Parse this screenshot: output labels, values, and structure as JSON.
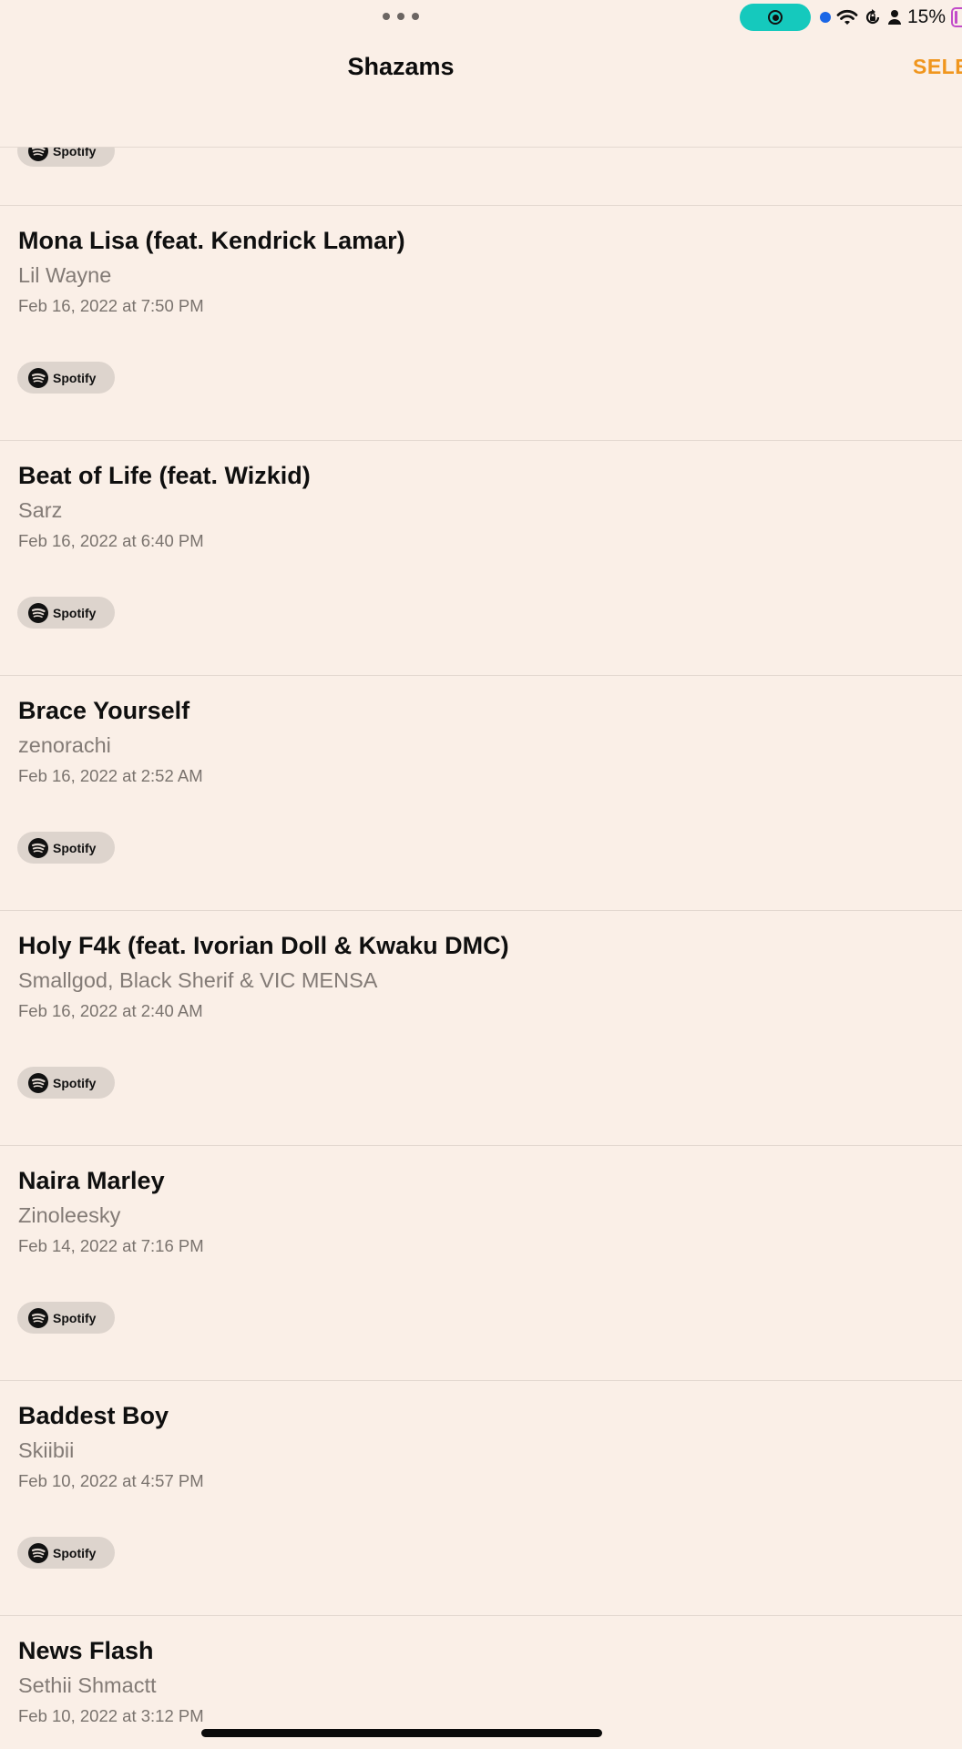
{
  "status_bar": {
    "battery_percent": "15%",
    "icons": [
      "multitask-dots-icon",
      "screen-record-icon",
      "location-dot-icon",
      "wifi-icon",
      "orientation-lock-icon",
      "person-icon",
      "battery-icon"
    ],
    "record_color": "#15c9bd",
    "battery_color": "#c24cc9"
  },
  "nav": {
    "title": "Shazams",
    "select_label": "SELECT",
    "accent_color": "#f0961e"
  },
  "partial_item": {
    "spotify_label": "Spotify"
  },
  "items": [
    {
      "title": "Mona Lisa (feat. Kendrick Lamar)",
      "artist": "Lil Wayne",
      "date": "Feb 16, 2022 at 7:50 PM",
      "spotify_label": "Spotify"
    },
    {
      "title": "Beat of Life (feat. Wizkid)",
      "artist": "Sarz",
      "date": "Feb 16, 2022 at 6:40 PM",
      "spotify_label": "Spotify"
    },
    {
      "title": "Brace Yourself",
      "artist": "zenorachi",
      "date": "Feb 16, 2022 at 2:52 AM",
      "spotify_label": "Spotify"
    },
    {
      "title": "Holy F4k (feat. Ivorian Doll & Kwaku DMC)",
      "artist": "Smallgod, Black Sherif & VIC MENSA",
      "date": "Feb 16, 2022 at 2:40 AM",
      "spotify_label": "Spotify"
    },
    {
      "title": "Naira Marley",
      "artist": "Zinoleesky",
      "date": "Feb 14, 2022 at 7:16 PM",
      "spotify_label": "Spotify"
    },
    {
      "title": "Baddest Boy",
      "artist": "Skiibii",
      "date": "Feb 10, 2022 at 4:57 PM",
      "spotify_label": "Spotify"
    }
  ],
  "last_item": {
    "title": "News Flash",
    "artist": "Sethii Shmactt",
    "date": "Feb 10, 2022 at 3:12 PM"
  }
}
